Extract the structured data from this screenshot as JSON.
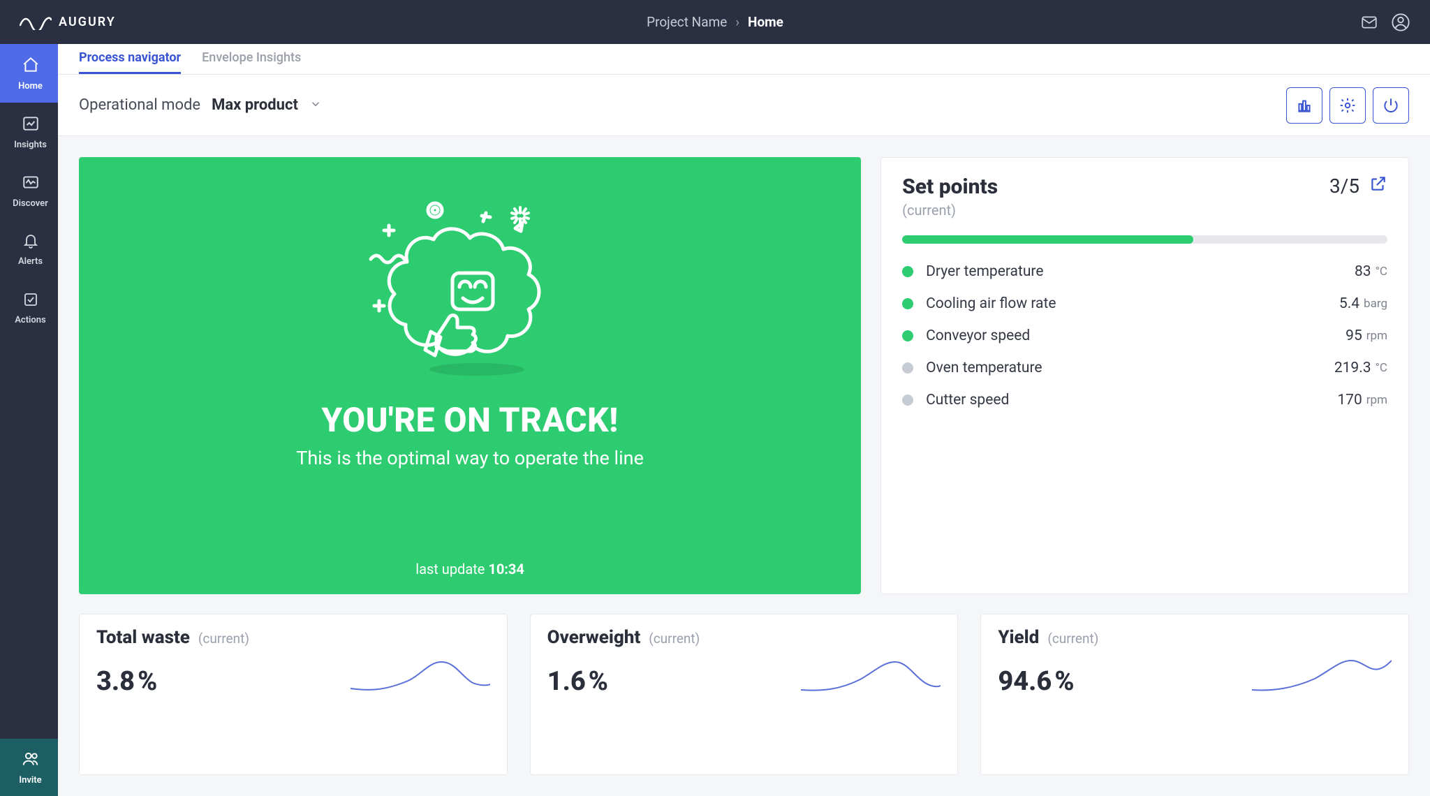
{
  "brand": {
    "name": "AUGURY"
  },
  "breadcrumb": {
    "project": "Project Name",
    "current": "Home"
  },
  "sidebar": {
    "items": [
      {
        "label": "Home",
        "icon": "home-icon",
        "active": true
      },
      {
        "label": "Insights",
        "icon": "insights-icon",
        "active": false
      },
      {
        "label": "Discover",
        "icon": "discover-icon",
        "active": false
      },
      {
        "label": "Alerts",
        "icon": "alerts-icon",
        "active": false
      },
      {
        "label": "Actions",
        "icon": "actions-icon",
        "active": false
      }
    ],
    "invite": {
      "label": "Invite"
    }
  },
  "tabs": [
    {
      "label": "Process navigator",
      "active": true
    },
    {
      "label": "Envelope Insights",
      "active": false
    }
  ],
  "toolbar": {
    "mode_label": "Operational mode",
    "mode_value": "Max product"
  },
  "hero": {
    "title": "YOU'RE ON TRACK!",
    "subtitle": "This is the optimal way to operate the line",
    "last_update_label": "last update",
    "last_update_time": "10:34"
  },
  "setpoints": {
    "title": "Set points",
    "subtitle": "(current)",
    "count_on": 3,
    "count_total": 5,
    "count_display": "3/5",
    "progress_percent": 60,
    "items": [
      {
        "name": "Dryer temperature",
        "value": "83",
        "unit": "°C",
        "on": true
      },
      {
        "name": "Cooling air flow rate",
        "value": "5.4",
        "unit": "barg",
        "on": true
      },
      {
        "name": "Conveyor speed",
        "value": "95",
        "unit": "rpm",
        "on": true
      },
      {
        "name": "Oven temperature",
        "value": "219.3",
        "unit": "°C",
        "on": false
      },
      {
        "name": "Cutter speed",
        "value": "170",
        "unit": "rpm",
        "on": false
      }
    ]
  },
  "kpis": [
    {
      "title": "Total waste",
      "subtitle": "(current)",
      "value": "3.8",
      "unit": "%"
    },
    {
      "title": "Overweight",
      "subtitle": "(current)",
      "value": "1.6",
      "unit": "%"
    },
    {
      "title": "Yield",
      "subtitle": "(current)",
      "value": "94.6",
      "unit": "%"
    }
  ]
}
